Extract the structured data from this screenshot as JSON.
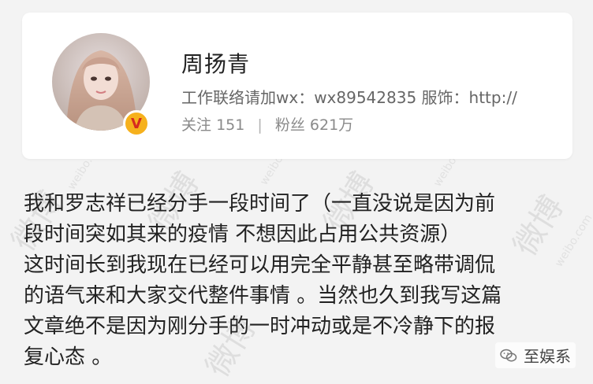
{
  "profile": {
    "name": "周扬青",
    "bio": "工作联络请加wx：wx89542835 服饰：http://",
    "following_label": "关注",
    "following_count": "151",
    "followers_label": "粉丝",
    "followers_count": "621万",
    "verified_badge": "V"
  },
  "post": {
    "lines": [
      "我和罗志祥已经分手一段时间了（一直没说是因为前",
      "段时间突如其来的疫情 不想因此占用公共资源）",
      "这时间长到我现在已经可以用完全平静甚至略带调侃",
      "的语气来和大家交代整件事情 。当然也久到我写这篇",
      "文章绝不是因为刚分手的一时冲动或是不冷静下的报",
      "复心态 。"
    ]
  },
  "watermarks": {
    "brand": "微博",
    "domain": "weibo.com"
  },
  "source_tag": {
    "label": "至娱系"
  },
  "colors": {
    "background": "#f3f3f3",
    "card": "#ffffff",
    "badge": "#f6b11d",
    "badge_text": "#d62a1f"
  },
  "icons": {
    "verified": "verified-badge-icon",
    "wechat": "wechat-icon"
  }
}
